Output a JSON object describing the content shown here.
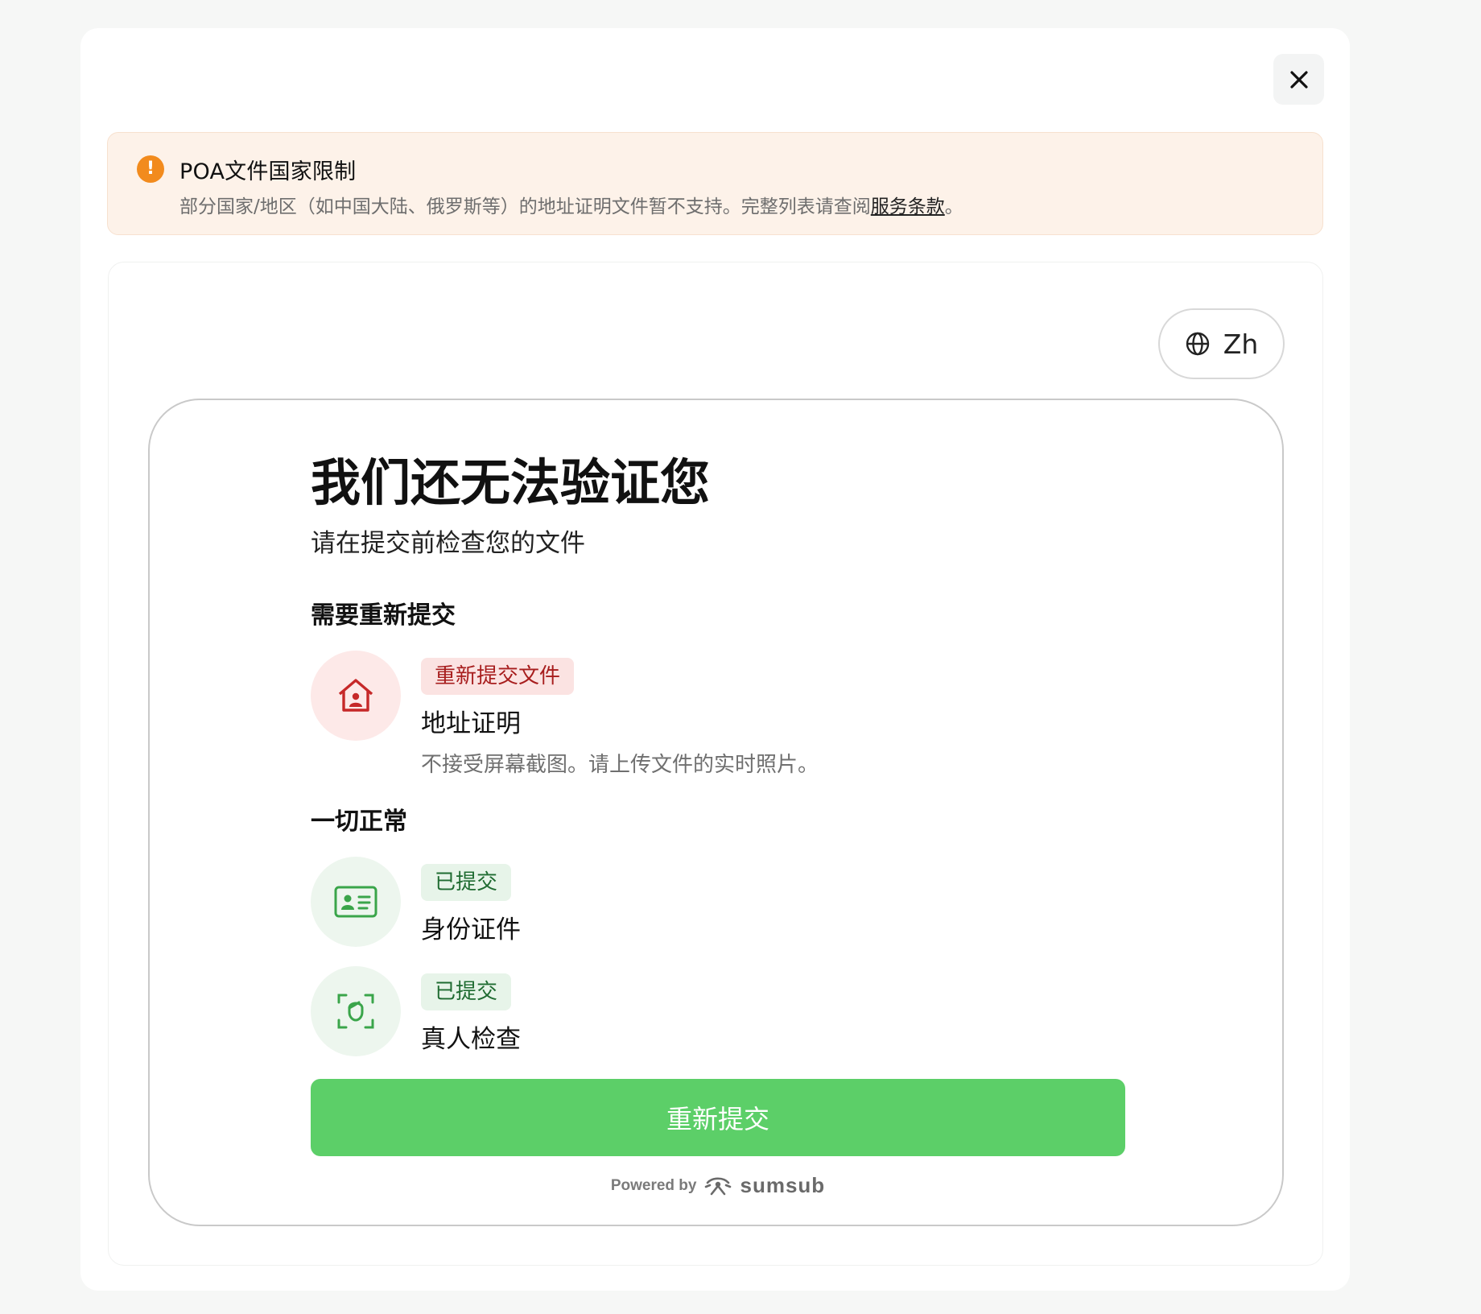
{
  "alert": {
    "title": "POA文件国家限制",
    "text": "部分国家/地区（如中国大陆、俄罗斯等）的地址证明文件暂不支持。完整列表请查阅",
    "link": "服务条款",
    "suffix": "。",
    "icon": "warning-icon",
    "color": "#f28b1d"
  },
  "language": {
    "label": "Zh",
    "icon": "globe-icon"
  },
  "main": {
    "title": "我们还无法验证您",
    "subtitle": "请在提交前检查您的文件",
    "resubmit_section": {
      "title": "需要重新提交",
      "items": [
        {
          "badge": "重新提交文件",
          "title": "地址证明",
          "note": "不接受屏幕截图。请上传文件的实时照片。",
          "icon": "house-person-icon"
        }
      ]
    },
    "ok_section": {
      "title": "一切正常",
      "items": [
        {
          "badge": "已提交",
          "title": "身份证件",
          "icon": "id-card-icon"
        },
        {
          "badge": "已提交",
          "title": "真人检查",
          "icon": "face-scan-icon"
        }
      ]
    },
    "button_label": "重新提交"
  },
  "footer": {
    "powered_by": "Powered by",
    "brand": "sumsub"
  },
  "colors": {
    "primary": "#5ccf68",
    "danger": "#a71d1d",
    "success": "#1f6b31"
  }
}
